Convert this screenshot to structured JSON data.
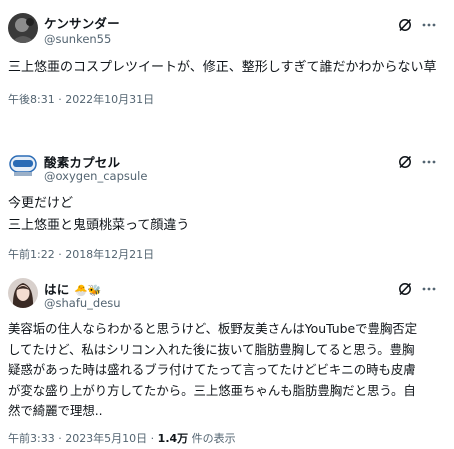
{
  "posts": [
    {
      "name": "ケンサンダー",
      "handle": "@sunken55",
      "lines": [
        "三上悠亜のコスプレツイートが、修正、整形しすぎて誰だかわからない草"
      ],
      "time": "午後8:31 · 2022年10月31日",
      "avatar_icon": "dark-portrait-avatar"
    },
    {
      "name": "酸素カプセル",
      "handle": "@oxygen_capsule",
      "lines": [
        "今更だけど",
        "三上悠亜と鬼頭桃菜って顔違う"
      ],
      "time": "午前1:22 · 2018年12月21日",
      "avatar_icon": "oxygen-capsule-avatar"
    },
    {
      "name": "はに",
      "name_emoji": "🐣🐝",
      "handle": "@shafu_desu",
      "lines": [
        "美容垢の住人ならわかると思うけど、板野友美さんはYouTubeで豊胸否定",
        "してたけど、私はシリコン入れた後に抜いて脂肪豊胸してると思う。豊胸",
        "疑惑があった時は盛れるブラ付けてたって言ってたけどビキニの時も皮膚",
        "が変な盛り上がり方してたから。三上悠亜ちゃんも脂肪豊胸だと思う。自",
        "然で綺麗で理想.."
      ],
      "time": "午前3:33 · 2023年5月10日 · ",
      "views_count": "1.4万",
      "views_label": " 件の表示",
      "avatar_icon": "girl-portrait-avatar"
    }
  ],
  "icons": {
    "grok": "grok-slash-icon",
    "more": "more-dots-icon"
  },
  "colors": {
    "text": "#0f1419",
    "secondary": "#536471"
  }
}
